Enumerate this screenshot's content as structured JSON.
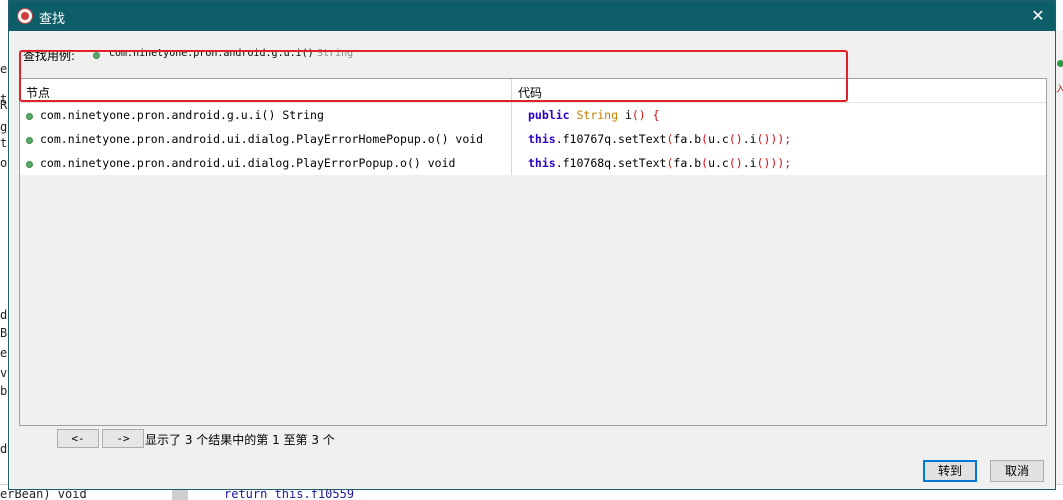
{
  "dialog": {
    "title": "查找",
    "close_symbol": "✕",
    "example_label": "查找用例:",
    "example_signature": "com.ninetyone.pron.android.g.u.i()",
    "example_return_type": "String"
  },
  "table": {
    "headers": [
      "节点",
      "代码"
    ],
    "rows": [
      {
        "node": "com.ninetyone.pron.android.g.u.i() String",
        "code_parts": [
          {
            "t": "public ",
            "c": "kw"
          },
          {
            "t": "String",
            "c": "ty"
          },
          {
            "t": " i",
            "c": ""
          },
          {
            "t": "() {",
            "c": "pn"
          }
        ]
      },
      {
        "node": "com.ninetyone.pron.android.ui.dialog.PlayErrorHomePopup.o() void",
        "code_parts": [
          {
            "t": "this",
            "c": "kw"
          },
          {
            "t": ".f10767q.setText",
            "c": ""
          },
          {
            "t": "(",
            "c": "pn"
          },
          {
            "t": "fa.b",
            "c": ""
          },
          {
            "t": "(",
            "c": "pn"
          },
          {
            "t": "u.c",
            "c": ""
          },
          {
            "t": "()",
            "c": "pn"
          },
          {
            "t": ".i",
            "c": ""
          },
          {
            "t": "()));",
            "c": "pn"
          }
        ]
      },
      {
        "node": "com.ninetyone.pron.android.ui.dialog.PlayErrorPopup.o() void",
        "code_parts": [
          {
            "t": "this",
            "c": "kw"
          },
          {
            "t": ".f10768q.setText",
            "c": ""
          },
          {
            "t": "(",
            "c": "pn"
          },
          {
            "t": "fa.b",
            "c": ""
          },
          {
            "t": "(",
            "c": "pn"
          },
          {
            "t": "u.c",
            "c": ""
          },
          {
            "t": "()",
            "c": "pn"
          },
          {
            "t": ".i",
            "c": ""
          },
          {
            "t": "()));",
            "c": "pn"
          }
        ]
      }
    ]
  },
  "footer": {
    "prev_label": "<-",
    "next_label": "->",
    "status": "显示了 3 个结果中的第 1 至第 3 个",
    "goto_label": "转到",
    "cancel_label": "取消"
  },
  "background": {
    "left_letters": [
      "e",
      "t",
      "R",
      "g",
      "t",
      "o",
      "d",
      "B",
      "e",
      "v",
      "b",
      "d"
    ],
    "bottom_text": "erBean) void",
    "bottom_code": "return this.f10559",
    "right_glyph": "入"
  },
  "colors": {
    "titlebar": "#0e5e6a",
    "keyword": "#2a00c8",
    "type": "#c08000",
    "punct": "#d01010",
    "highlight_border": "#e0202a"
  }
}
